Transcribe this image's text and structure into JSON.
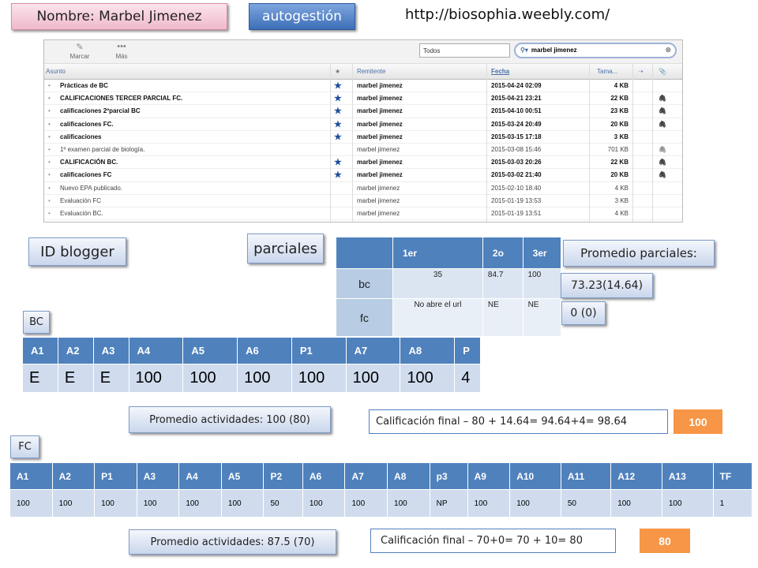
{
  "header": {
    "name": "Nombre: Marbel Jimenez",
    "autogestion": "autogestión",
    "url": "http://biosophia.weebly.com/"
  },
  "mail": {
    "toolbar": {
      "marcar": "Marcar",
      "mas": "Más",
      "left_cut": "ar"
    },
    "filter": "Todos",
    "search_value": "marbel jimenez",
    "columns": {
      "asunto": "Asunto",
      "remitente": "Remitente",
      "fecha": "Fecha",
      "tamano": "Tama..."
    },
    "rows": [
      {
        "subject": "Prácticas de BC",
        "star": true,
        "from": "marbel jimenez",
        "date": "2015-04-24 02:09",
        "size": "4 KB",
        "attach": false,
        "unread": true
      },
      {
        "subject": "CALIFICACIONES TERCER PARCIAL FC.",
        "star": true,
        "from": "marbel jimenez",
        "date": "2015-04-21 23:21",
        "size": "22 KB",
        "attach": true,
        "unread": true
      },
      {
        "subject": "calificaciones 2ºparcial BC",
        "star": true,
        "from": "marbel jimenez",
        "date": "2015-04-10 00:51",
        "size": "23 KB",
        "attach": true,
        "unread": true
      },
      {
        "subject": "calificaciones FC.",
        "star": true,
        "from": "marbel jimenez",
        "date": "2015-03-24 20:49",
        "size": "20 KB",
        "attach": true,
        "unread": true
      },
      {
        "subject": "calificaciones",
        "star": true,
        "from": "marbel jimenez",
        "date": "2015-03-15 17:18",
        "size": "3 KB",
        "attach": false,
        "unread": true
      },
      {
        "subject": "1º examen parcial de biología.",
        "star": false,
        "from": "marbel jimenez",
        "date": "2015-03-08 15:46",
        "size": "701 KB",
        "attach": true,
        "unread": false
      },
      {
        "subject": "CALIFICACIÓN BC.",
        "star": true,
        "from": "marbel jimenez",
        "date": "2015-03-03 20:26",
        "size": "22 KB",
        "attach": true,
        "unread": true
      },
      {
        "subject": "calificaciones FC",
        "star": true,
        "from": "marbel jimenez",
        "date": "2015-03-02 21:40",
        "size": "20 KB",
        "attach": true,
        "unread": true
      },
      {
        "subject": "Nuevo EPA publicado.",
        "star": false,
        "from": "marbel jimenez",
        "date": "2015-02-10 18:40",
        "size": "4 KB",
        "attach": false,
        "unread": false
      },
      {
        "subject": "Evaluación FC",
        "star": false,
        "from": "marbel jimenez",
        "date": "2015-01-19 13:53",
        "size": "3 KB",
        "attach": false,
        "unread": false
      },
      {
        "subject": "Evaluación BC.",
        "star": false,
        "from": "marbel jimenez",
        "date": "2015-01-19 13:51",
        "size": "4 KB",
        "attach": false,
        "unread": false
      }
    ]
  },
  "id_blogger": "ID blogger",
  "parciales": {
    "label": "parciales",
    "headers": [
      "1er",
      "2o",
      "3er"
    ],
    "rows": [
      {
        "name": "bc",
        "values": [
          "35",
          "84.7",
          "100"
        ]
      },
      {
        "name": "fc",
        "values": [
          "No abre el url",
          "NE",
          "NE"
        ]
      }
    ],
    "promedio_label": "Promedio parciales:",
    "promedio_bc": "73.23(14.64)",
    "promedio_fc": "0 (0)"
  },
  "bc": {
    "label": "BC",
    "headers": [
      "A1",
      "A2",
      "A3",
      "A4",
      "A5",
      "A6",
      "P1",
      "A7",
      "A8",
      "P"
    ],
    "values": [
      "E",
      "E",
      "E",
      "100",
      "100",
      "100",
      "100",
      "100",
      "100",
      "4"
    ],
    "promedio": "Promedio actividades: 100 (80)",
    "final": "Calificación final – 80 + 14.64= 94.64+4= 98.64",
    "score": "100"
  },
  "fc": {
    "label": "FC",
    "headers": [
      "A1",
      "A2",
      "P1",
      "A3",
      "A4",
      "A5",
      "P2",
      "A6",
      "A7",
      "A8",
      "p3",
      "A9",
      "A10",
      "A11",
      "A12",
      "A13",
      "TF"
    ],
    "values": [
      "100",
      "100",
      "100",
      "100",
      "100",
      "100",
      "50",
      "100",
      "100",
      "100",
      "NP",
      "100",
      "100",
      "50",
      "100",
      "100",
      "1"
    ],
    "promedio": "Promedio actividades: 87.5 (70)",
    "final": "Calificación final – 70+0= 70 + 10= 80",
    "score": "80"
  }
}
